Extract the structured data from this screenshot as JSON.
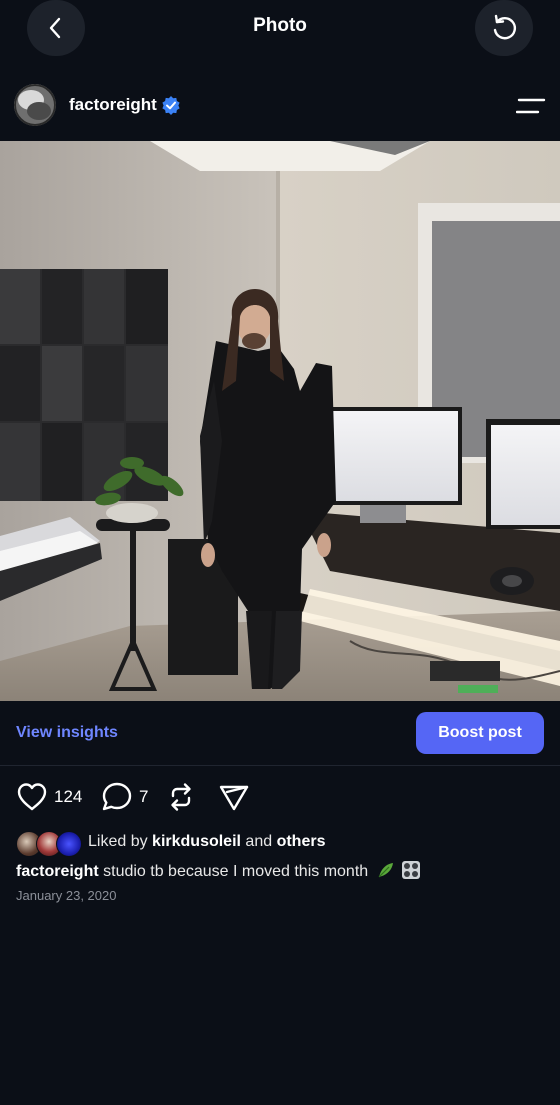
{
  "header": {
    "title": "Photo"
  },
  "profile": {
    "username": "factoreight"
  },
  "actions_bar": {
    "view_insights_label": "View insights",
    "boost_label": "Boost post",
    "likes_count": "124",
    "comments_count": "7"
  },
  "likes": {
    "prefix": "Liked by",
    "user": "kirkdusoleil",
    "joiner": "and",
    "suffix": "others"
  },
  "post": {
    "author": "factoreight",
    "caption": "studio tb because I moved this month",
    "date": "January 23, 2020"
  },
  "colors": {
    "background": "#0b0f17",
    "accent_link": "#6f86ff",
    "boost_button": "#5566f5",
    "verified_badge": "#3b82f6"
  },
  "icons": [
    "back-icon",
    "refresh-icon",
    "verified-icon",
    "menu-icon",
    "heart-icon",
    "comment-icon",
    "repost-icon",
    "share-icon",
    "leaf-emoji-icon",
    "knobs-emoji-icon"
  ]
}
